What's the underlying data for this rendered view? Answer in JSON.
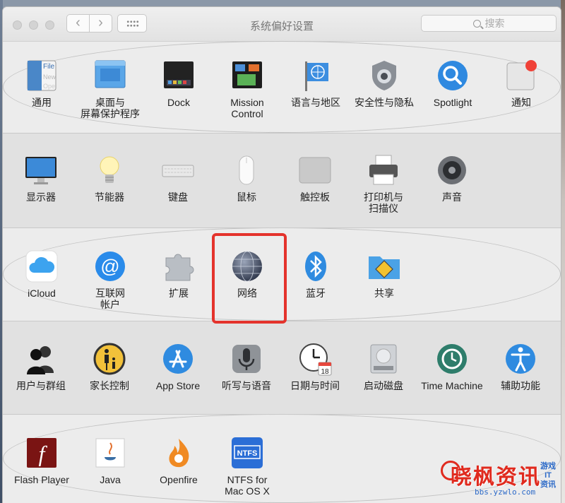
{
  "window": {
    "title": "系统偏好设置",
    "search_placeholder": "搜索",
    "back_glyph": "‹",
    "forward_glyph": "›"
  },
  "sections": [
    [
      {
        "id": "general",
        "label": "通用",
        "icon": "general-icon"
      },
      {
        "id": "desktop",
        "label": "桌面与\n屏幕保护程序",
        "icon": "desktop-screensaver-icon"
      },
      {
        "id": "dock",
        "label": "Dock",
        "icon": "dock-icon"
      },
      {
        "id": "mission",
        "label": "Mission\nControl",
        "icon": "mission-control-icon"
      },
      {
        "id": "language",
        "label": "语言与地区",
        "icon": "language-region-icon"
      },
      {
        "id": "security",
        "label": "安全性与隐私",
        "icon": "security-privacy-icon"
      },
      {
        "id": "spotlight",
        "label": "Spotlight",
        "icon": "spotlight-icon"
      },
      {
        "id": "notifications",
        "label": "通知",
        "icon": "notifications-icon"
      }
    ],
    [
      {
        "id": "displays",
        "label": "显示器",
        "icon": "displays-icon"
      },
      {
        "id": "energy",
        "label": "节能器",
        "icon": "energy-saver-icon"
      },
      {
        "id": "keyboard",
        "label": "键盘",
        "icon": "keyboard-icon"
      },
      {
        "id": "mouse",
        "label": "鼠标",
        "icon": "mouse-icon"
      },
      {
        "id": "trackpad",
        "label": "触控板",
        "icon": "trackpad-icon"
      },
      {
        "id": "printers",
        "label": "打印机与\n扫描仪",
        "icon": "printer-scanner-icon"
      },
      {
        "id": "sound",
        "label": "声音",
        "icon": "sound-icon"
      }
    ],
    [
      {
        "id": "icloud",
        "label": "iCloud",
        "icon": "icloud-icon"
      },
      {
        "id": "internet",
        "label": "互联网\n帐户",
        "icon": "internet-accounts-icon"
      },
      {
        "id": "extensions",
        "label": "扩展",
        "icon": "extensions-icon"
      },
      {
        "id": "network",
        "label": "网络",
        "icon": "network-icon"
      },
      {
        "id": "bluetooth",
        "label": "蓝牙",
        "icon": "bluetooth-icon"
      },
      {
        "id": "sharing",
        "label": "共享",
        "icon": "sharing-icon"
      }
    ],
    [
      {
        "id": "users",
        "label": "用户与群组",
        "icon": "users-groups-icon"
      },
      {
        "id": "parental",
        "label": "家长控制",
        "icon": "parental-controls-icon"
      },
      {
        "id": "appstore",
        "label": "App Store",
        "icon": "app-store-icon"
      },
      {
        "id": "dictation",
        "label": "听写与语音",
        "icon": "dictation-speech-icon"
      },
      {
        "id": "datetime",
        "label": "日期与时间",
        "icon": "date-time-icon"
      },
      {
        "id": "startup",
        "label": "启动磁盘",
        "icon": "startup-disk-icon"
      },
      {
        "id": "timemachine",
        "label": "Time Machine",
        "icon": "time-machine-icon"
      },
      {
        "id": "accessibility",
        "label": "辅助功能",
        "icon": "accessibility-icon"
      }
    ],
    [
      {
        "id": "flash",
        "label": "Flash Player",
        "icon": "flash-player-icon"
      },
      {
        "id": "java",
        "label": "Java",
        "icon": "java-icon"
      },
      {
        "id": "openfire",
        "label": "Openfire",
        "icon": "openfire-icon"
      },
      {
        "id": "ntfs",
        "label": "NTFS for\nMac OS X",
        "icon": "ntfs-icon"
      }
    ]
  ],
  "icon_text": {
    "general_file": "File",
    "general_new": "New",
    "general_ope": "Ope",
    "calendar_day": "18",
    "ntfs_badge": "NTFS",
    "flash_glyph": "f"
  },
  "watermark": {
    "main": "晓枫资讯",
    "url": "bbs.yzwlo.com",
    "side": "游戏\nIT\n资讯"
  },
  "colors": {
    "highlight": "#e4332c"
  }
}
